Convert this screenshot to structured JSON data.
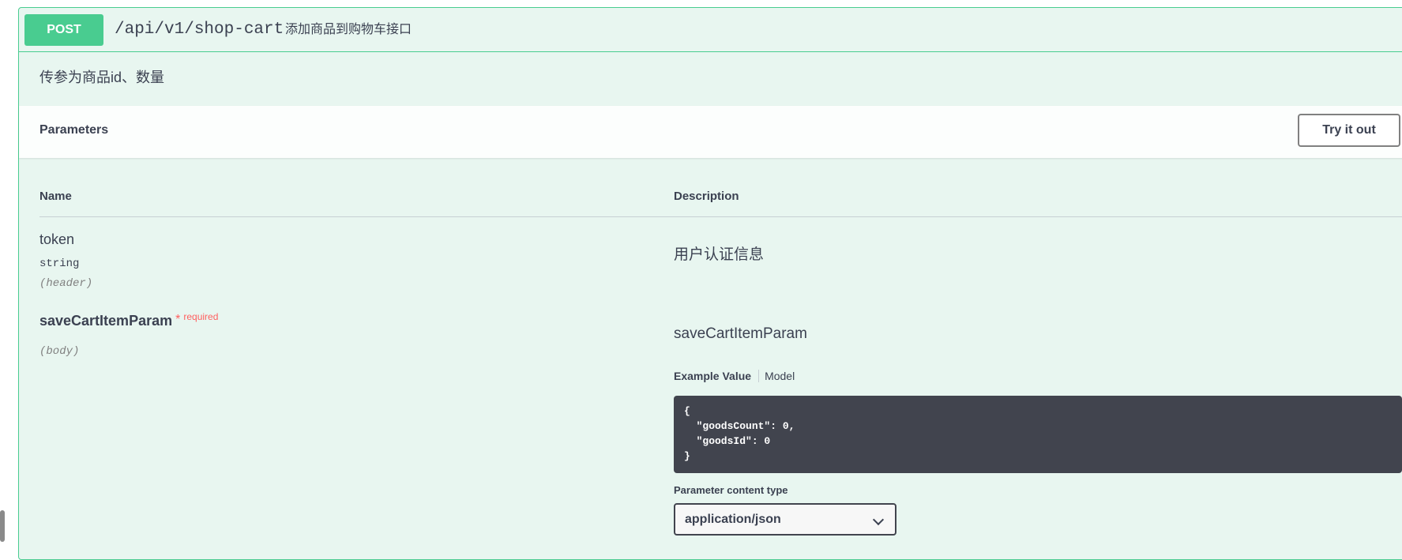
{
  "operation": {
    "method": "POST",
    "path": "/api/v1/shop-cart",
    "summary": "添加商品到购物车接口",
    "description": "传参为商品id、数量",
    "method_color": "#49cc90"
  },
  "parameters_section": {
    "title": "Parameters",
    "try_button_label": "Try it out"
  },
  "columns": {
    "name": "Name",
    "description": "Description"
  },
  "params": [
    {
      "name": "token",
      "type": "string",
      "in": "(header)",
      "description": "用户认证信息"
    },
    {
      "name": "saveCartItemParam",
      "required_star": "*",
      "required_label": "required",
      "in": "(body)",
      "description": "saveCartItemParam",
      "tabs": {
        "example": "Example Value",
        "model": "Model"
      },
      "example_json": "{\n  \"goodsCount\": 0,\n  \"goodsId\": 0\n}",
      "content_type_label": "Parameter content type",
      "content_type_value": "application/json"
    }
  ],
  "icons": {
    "select_chevron": "chevron-down-icon"
  },
  "colors": {
    "post_bg": "#e8f6f0",
    "post_border": "#49cc90",
    "required": "#ff6060",
    "code_bg": "#41444e"
  }
}
